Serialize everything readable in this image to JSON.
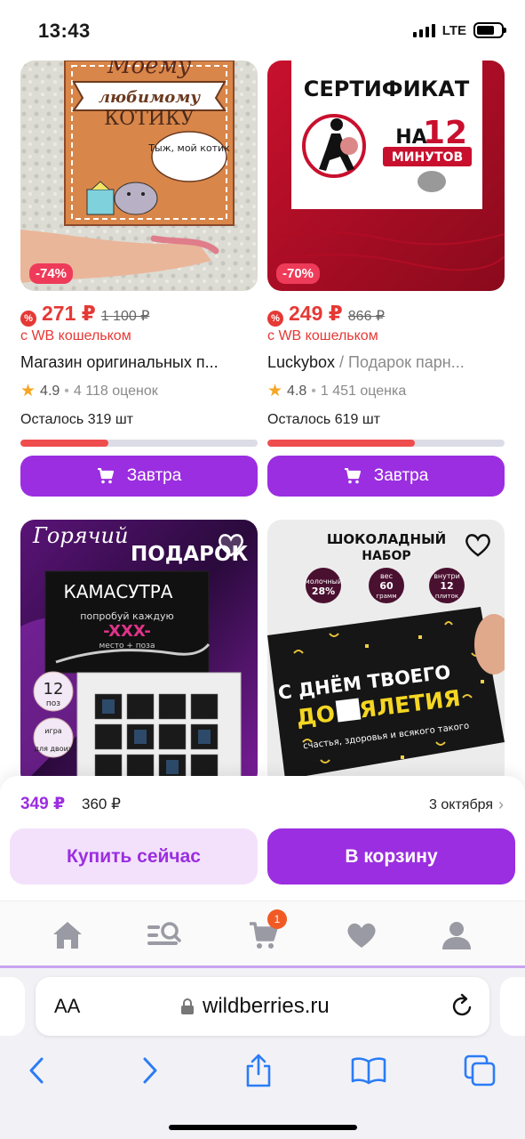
{
  "status_bar": {
    "time": "13:43",
    "network": "LTE"
  },
  "products": [
    {
      "image_caption": [
        "Моему",
        "любимому",
        "КОТИКУ",
        "Тыж, мой котик"
      ],
      "discount": "-74%",
      "price": "271 ₽",
      "old_price": "1 100 ₽",
      "wallet_note": "с WB кошельком",
      "brand": "Магазин оригинальных п...",
      "subtitle": "",
      "rating": "4.9",
      "reviews": "4 118 оценок",
      "stock": "Осталось 319 шт",
      "stock_level": 0.37,
      "delivery": "Завтра"
    },
    {
      "image_caption": [
        "СЕРТИФИКАТ",
        "НА",
        "12",
        "МИНУТОВ"
      ],
      "discount": "-70%",
      "price": "249 ₽",
      "old_price": "866 ₽",
      "wallet_note": "с WB кошельком",
      "brand": "Luckybox",
      "subtitle": " / Подарок парн...",
      "rating": "4.8",
      "reviews": "1 451 оценка",
      "stock": "Осталось 619 шт",
      "stock_level": 0.62,
      "delivery": "Завтра"
    },
    {
      "image_caption": [
        "Горячий",
        "ПОДАРОК",
        "КАМАСУТРА",
        "попробуй каждую",
        "-XXX-",
        "место + поза",
        "12",
        "поз",
        "игра",
        "для двоих"
      ]
    },
    {
      "image_caption": [
        "ШОКОЛАДНЫЙ",
        "НАБОР",
        "молочный",
        "28%",
        "вес",
        "60",
        "грамм",
        "внутри",
        "12",
        "плиток",
        "С ДНЁМ ТВОЕГО",
        "ДО УЯЛЕТИЯ",
        "счастья, здоровья и всякого такого"
      ]
    }
  ],
  "buy_panel": {
    "price": "349 ₽",
    "old_price": "360 ₽",
    "delivery_date": "3 октября",
    "buy_now": "Купить сейчас",
    "add_to_cart": "В корзину"
  },
  "app_tabs": {
    "cart_count": "1"
  },
  "browser": {
    "aa_label": "AA",
    "url": "wildberries.ru"
  },
  "colors": {
    "accent": "#9b2ee0",
    "price_red": "#e53935",
    "discount_badge": "#ee3b59"
  }
}
